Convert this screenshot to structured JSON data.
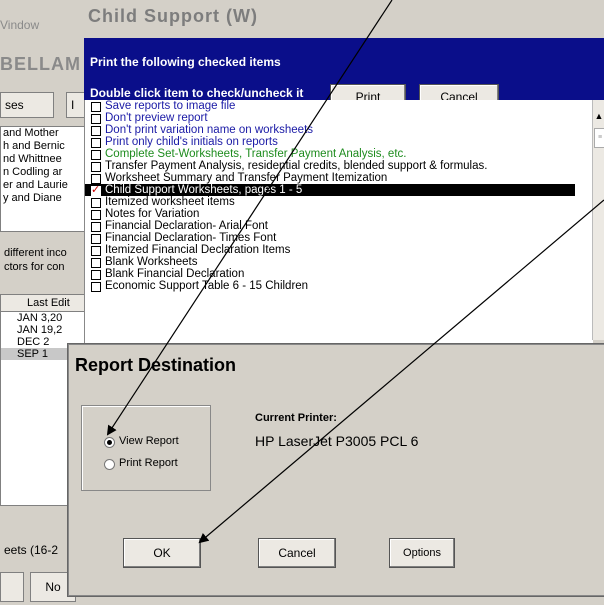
{
  "background_window": {
    "menu_text": "Vindow",
    "title_fragment": "BELLAM",
    "tab1": "ses",
    "tab2": "I",
    "list_items": [
      "and Mother",
      "h and Bernic",
      "nd Whittnee",
      "n Codling ar",
      "er and Laurie",
      "y and Diane"
    ],
    "text_line1": "different inco",
    "text_line2": "ctors for con",
    "table_header": "Last Edit",
    "table_rows": [
      "JAN  3,20",
      "JAN 19,2",
      "DEC  2",
      "SEP  1"
    ],
    "bottom_label": "eets (16-2",
    "bottom_button2": "No"
  },
  "child_support_dialog": {
    "title": "Child Support (W)",
    "header_line1": "Print the following checked items",
    "header_line2": "Double click item to check/uncheck it",
    "print_button": "Print",
    "cancel_button": "Cancel",
    "items": [
      {
        "label": "Save reports to image file",
        "color": "#1a1aa6",
        "checked": false,
        "selected": false
      },
      {
        "label": "Don't preview report",
        "color": "#1a1aa6",
        "checked": false,
        "selected": false
      },
      {
        "label": "Don't print variation name on worksheets",
        "color": "#1a1aa6",
        "checked": false,
        "selected": false
      },
      {
        "label": "Print only child's initials on reports",
        "color": "#1a1aa6",
        "checked": false,
        "selected": false
      },
      {
        "label": "Complete Set-Worksheets, Transfer Payment Analysis, etc.",
        "color": "#1e8c1e",
        "checked": false,
        "selected": false
      },
      {
        "label": "Transfer Payment Analysis, residential credits, blended support & formulas.",
        "color": "#000000",
        "checked": false,
        "selected": false
      },
      {
        "label": "Worksheet Summary and Transfer Payment Itemization",
        "color": "#000000",
        "checked": false,
        "selected": false
      },
      {
        "label": "Child Support Worksheets, pages 1 - 5",
        "color": "#ffffff",
        "checked": true,
        "selected": true
      },
      {
        "label": "Itemized worksheet items",
        "color": "#000000",
        "checked": false,
        "selected": false
      },
      {
        "label": "Notes for Variation",
        "color": "#000000",
        "checked": false,
        "selected": false
      },
      {
        "label": "Financial Declaration- Arial Font",
        "color": "#000000",
        "checked": false,
        "selected": false
      },
      {
        "label": "Financial Declaration- Times Font",
        "color": "#000000",
        "checked": false,
        "selected": false
      },
      {
        "label": "Itemized Financial Declaration Items",
        "color": "#000000",
        "checked": false,
        "selected": false
      },
      {
        "label": "Blank Worksheets",
        "color": "#000000",
        "checked": false,
        "selected": false
      },
      {
        "label": "Blank Financial Declaration",
        "color": "#000000",
        "checked": false,
        "selected": false
      },
      {
        "label": "Economic Support Table 6 - 15 Children",
        "color": "#000000",
        "checked": false,
        "selected": false
      }
    ]
  },
  "report_destination_dialog": {
    "title": "Report Destination",
    "radio_view": "View Report",
    "radio_print": "Print Report",
    "selected_option": "View Report",
    "printer_label": "Current Printer:",
    "printer_name": "HP LaserJet P3005 PCL 6",
    "ok_button": "OK",
    "cancel_button": "Cancel",
    "options_button": "Options"
  }
}
